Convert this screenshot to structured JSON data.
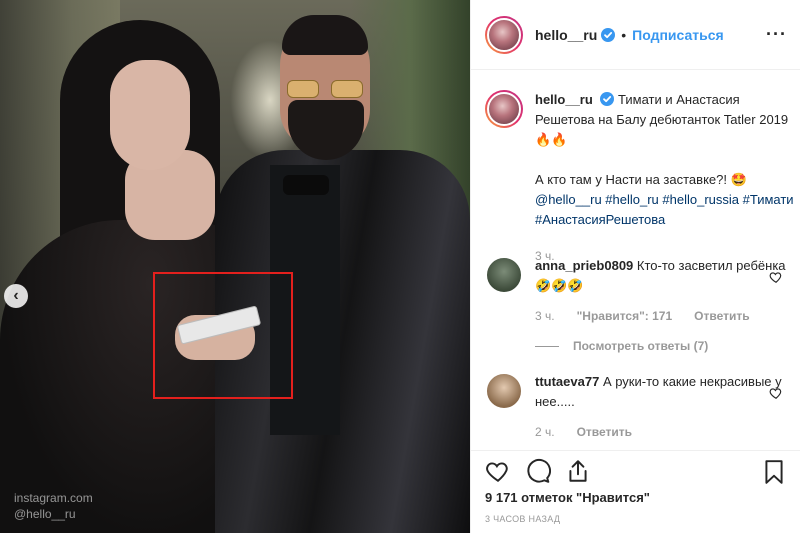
{
  "photo": {
    "watermark_line1": "instagram.com",
    "watermark_line2": "@hello__ru",
    "prev_arrow": "‹",
    "highlight_color": "#e3201d"
  },
  "header": {
    "username": "hello__ru",
    "separator": "•",
    "follow_label": "Подписаться",
    "more_label": "···",
    "verified_color": "#3897f0"
  },
  "caption": {
    "username": "hello__ru",
    "text_line1": "Тимати и Анастасия Решетова на Балу дебютанток Tatler 2019 🔥🔥",
    "text_line2": "А кто там у Насти на заставке?! 🤩",
    "tags": "@hello__ru #hello_ru #hello_russia #Тимати #АнастасияРешетова",
    "time": "3 ч."
  },
  "comments": [
    {
      "username": "anna_prieb0809",
      "text": "Кто-то засветил ребёнка 🤣🤣🤣",
      "time": "3 ч.",
      "likes": "\"Нравится\": 171",
      "reply_label": "Ответить",
      "view_replies": "Посмотреть ответы (7)"
    },
    {
      "username": "ttutaeva77",
      "text": "А руки-то какие некрасивые у нее.....",
      "time": "2 ч.",
      "reply_label": "Ответить"
    }
  ],
  "actions": {
    "like_icon": "heart-icon",
    "comment_icon": "comment-icon",
    "share_icon": "share-icon",
    "save_icon": "bookmark-icon"
  },
  "likes_text": "9 171 отметок \"Нравится\"",
  "time_ago": "3 ЧАСОВ НАЗАД"
}
